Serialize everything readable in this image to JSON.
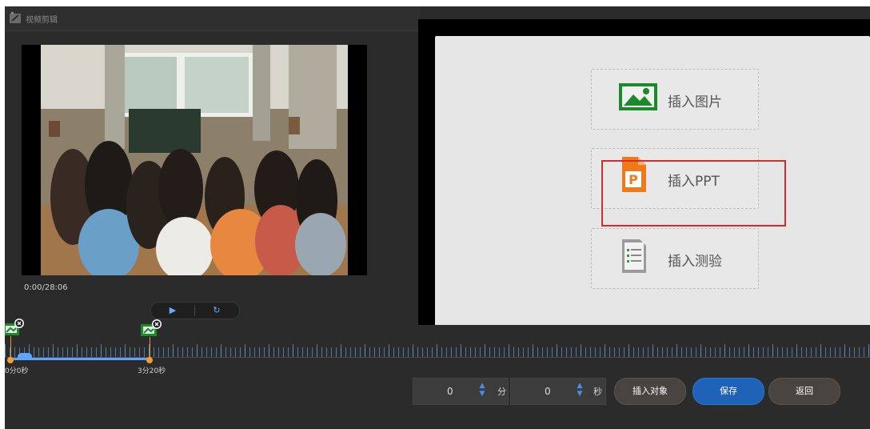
{
  "window": {
    "title": "视频剪辑"
  },
  "video": {
    "time": "0:00/28:06"
  },
  "controls": {
    "play_icon": "play-icon",
    "replay_icon": "replay-icon"
  },
  "insert_panel": {
    "image_label": "插入图片",
    "ppt_label": "插入PPT",
    "quiz_label": "插入测验"
  },
  "timeline": {
    "markers": [
      {
        "label": "0分0秒"
      },
      {
        "label": "3分20秒"
      }
    ]
  },
  "bottom": {
    "minutes_value": "0",
    "minutes_unit": "分",
    "seconds_value": "0",
    "seconds_unit": "秒",
    "insert_object_label": "插入对象",
    "save_label": "保存",
    "back_label": "返回"
  },
  "colors": {
    "accent": "#1f63b8",
    "highlight": "#d62b2b",
    "ppt_orange": "#f07a1a",
    "image_green": "#1a8a2a"
  }
}
